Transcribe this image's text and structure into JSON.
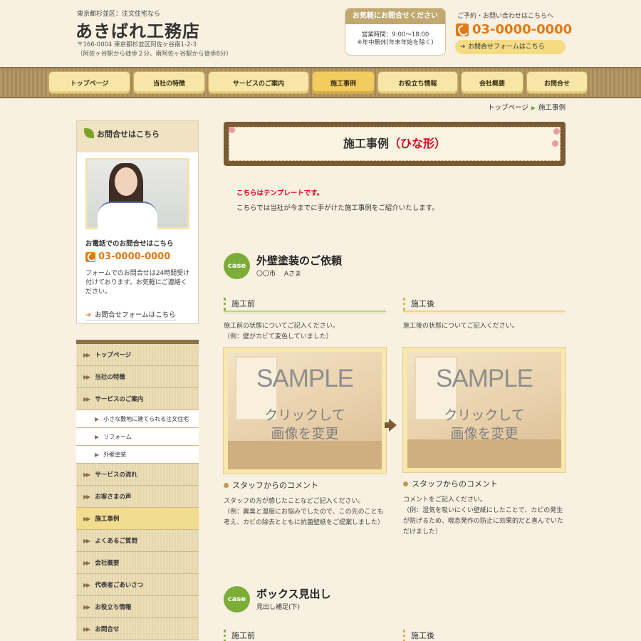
{
  "header": {
    "tagline": "東京都杉並区：注文住宅なら",
    "logo": "あきばれ工務店",
    "address_line1": "〒166-0004 東京都杉並区阿佐ヶ谷南1-2-3",
    "address_line2": "（阿佐ヶ谷駅から徒歩２分、南阿佐ヶ谷駅から徒歩8分）",
    "contact_box_title": "お気軽にお問合せください",
    "hours": "営業時間：9:00～18:00",
    "closed": "※年中無休(年末年始を除く)",
    "cta_small": "ご予約・お問い合わせはこちらへ",
    "phone": "03-0000-0000",
    "form_link": "お問合せフォームはこちら"
  },
  "nav": [
    {
      "label": "トップページ"
    },
    {
      "label": "当社の特徴"
    },
    {
      "label": "サービスのご案内"
    },
    {
      "label": "施工事例",
      "active": true
    },
    {
      "label": "お役立ち情報"
    },
    {
      "label": "会社概要"
    },
    {
      "label": "お問合せ"
    }
  ],
  "breadcrumb": {
    "home": "トップページ",
    "current": "施工事例"
  },
  "sidebar": {
    "contact_title": "お問合せはこちら",
    "phone_label": "お電話でのお問合せはこちら",
    "phone": "03-0000-0000",
    "note": "フォームでのお問合せは24時間受け付けております。お気軽にご連絡ください。",
    "form_link": "お問合せフォームはこちら",
    "menu": [
      {
        "label": "トップページ"
      },
      {
        "label": "当社の特徴"
      },
      {
        "label": "サービスのご案内"
      },
      {
        "label": "小さな敷地に建てられる注文住宅",
        "sub": true
      },
      {
        "label": "リフォーム",
        "sub": true
      },
      {
        "label": "外壁塗装",
        "sub": true
      },
      {
        "label": "サービスの流れ"
      },
      {
        "label": "お客さまの声"
      },
      {
        "label": "施工事例",
        "active": true
      },
      {
        "label": "よくあるご質問"
      },
      {
        "label": "会社概要"
      },
      {
        "label": "代表者ごあいさつ"
      },
      {
        "label": "お役立ち情報"
      },
      {
        "label": "お問合せ"
      }
    ]
  },
  "main": {
    "title": "施工事例",
    "title_red": "（ひな形）",
    "intro_red": "こちらはテンプレートです。",
    "intro": "こちらでは当社が今までに手がけた施工事例をご紹介いたします。",
    "cases": [
      {
        "badge": "case",
        "title": "外壁塗装のご依頼",
        "subtitle": "〇〇市　 Aさま",
        "before_heading": "施工前",
        "after_heading": "施工後",
        "before_desc": "施工前の状態についてご記入ください。\n（例：壁がカビて変色していました）",
        "after_desc": "施工後の状態についてご記入ください。",
        "sample_text": "SAMPLE",
        "click_text": "クリックして\n画像を変更",
        "comment_heading": "スタッフからのコメント",
        "before_comment": "スタッフの方が感じたことなどご記入ください。\n（例：異臭と湿度にお悩みでしたので、この先のことも考え、カビの除去とともに抗菌壁紙をご提案しました）",
        "after_comment": "コメントをご記入ください。\n（例：湿気を吸いにくい壁紙にしたことで、カビの発生が防げるため、喘息発作の防止に効果的だと喜んでいただけました）"
      },
      {
        "badge": "case",
        "title": "ボックス見出し",
        "subtitle": "見出し補足(下)",
        "before_heading": "施工前",
        "after_heading": "施工後"
      }
    ]
  },
  "colors": {
    "accent_orange": "#e07a16",
    "nav_active": "#f2cc5f",
    "case_badge_green": "#7bad38",
    "title_red": "#d9001b"
  }
}
